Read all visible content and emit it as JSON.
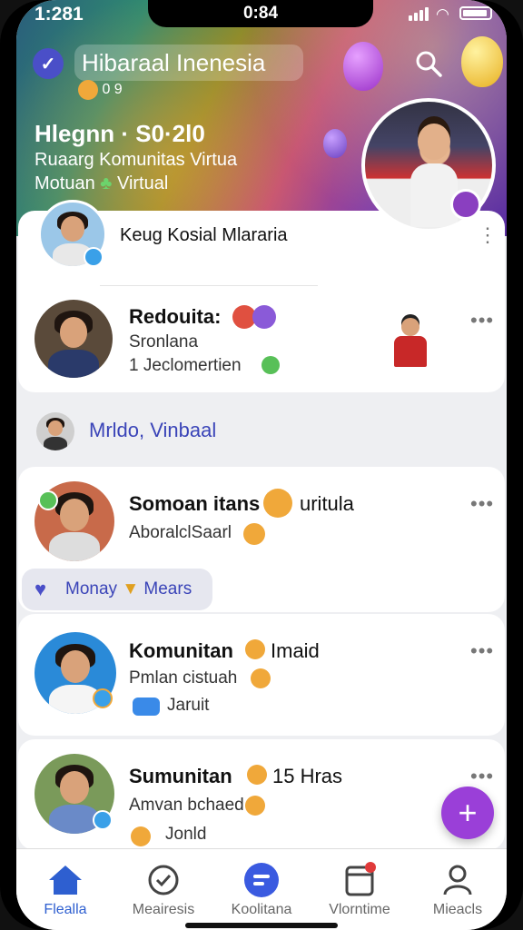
{
  "status_bar": {
    "time": "1:281",
    "center_time": "0:84"
  },
  "header": {
    "title": "Hibaraal Inenesia",
    "sub": "0 9",
    "group_title": "Hlegnn · S0·2l0",
    "group_subtitle": "Ruaarg Komunitas Virtua",
    "group_subtitle2": "Motuan",
    "group_subtitle2_suffix": "Virtual"
  },
  "cards": [
    {
      "name": "Keug Kosial Mlararia",
      "meta": "",
      "meta2": ""
    },
    {
      "name": "Redouita:",
      "meta": "Sronlana",
      "meta2": "1 Jeclomertien"
    },
    {
      "name": "Somoan itans",
      "name_suffix": "uritula",
      "meta": "AboralclSaarl",
      "meta2": ""
    },
    {
      "name": "Komunitan",
      "name_suffix": "Imaid",
      "meta": "Pmlan cistuah",
      "meta2": "Jaruit"
    },
    {
      "name": "Sumunitan",
      "name_suffix": "15 Hras",
      "meta": "Amvan bchaed",
      "meta2": "Jonld"
    }
  ],
  "section_label": "Mrldo, Vinbaal",
  "chip": {
    "label": "Monay",
    "suffix": "Mears"
  },
  "bottom_nav": [
    {
      "label": "Flealla",
      "icon": "home-icon"
    },
    {
      "label": "Meairesis",
      "icon": "check-circle-icon"
    },
    {
      "label": "Koolitana",
      "icon": "chat-icon"
    },
    {
      "label": "Vlorntime",
      "icon": "calendar-icon"
    },
    {
      "label": "Mieacls",
      "icon": "profile-icon"
    }
  ],
  "colors": {
    "accent": "#4a4fc8",
    "fab": "#9a3fd8",
    "active_nav": "#2e5fd0"
  }
}
